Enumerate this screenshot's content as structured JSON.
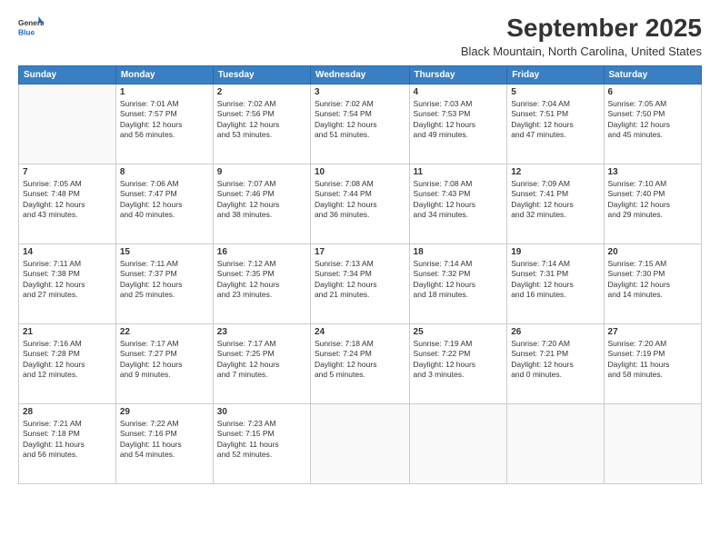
{
  "header": {
    "logo_general": "General",
    "logo_blue": "Blue",
    "month": "September 2025",
    "location": "Black Mountain, North Carolina, United States"
  },
  "columns": [
    "Sunday",
    "Monday",
    "Tuesday",
    "Wednesday",
    "Thursday",
    "Friday",
    "Saturday"
  ],
  "weeks": [
    [
      {
        "day": "",
        "info": ""
      },
      {
        "day": "1",
        "info": "Sunrise: 7:01 AM\nSunset: 7:57 PM\nDaylight: 12 hours\nand 56 minutes."
      },
      {
        "day": "2",
        "info": "Sunrise: 7:02 AM\nSunset: 7:56 PM\nDaylight: 12 hours\nand 53 minutes."
      },
      {
        "day": "3",
        "info": "Sunrise: 7:02 AM\nSunset: 7:54 PM\nDaylight: 12 hours\nand 51 minutes."
      },
      {
        "day": "4",
        "info": "Sunrise: 7:03 AM\nSunset: 7:53 PM\nDaylight: 12 hours\nand 49 minutes."
      },
      {
        "day": "5",
        "info": "Sunrise: 7:04 AM\nSunset: 7:51 PM\nDaylight: 12 hours\nand 47 minutes."
      },
      {
        "day": "6",
        "info": "Sunrise: 7:05 AM\nSunset: 7:50 PM\nDaylight: 12 hours\nand 45 minutes."
      }
    ],
    [
      {
        "day": "7",
        "info": "Sunrise: 7:05 AM\nSunset: 7:48 PM\nDaylight: 12 hours\nand 43 minutes."
      },
      {
        "day": "8",
        "info": "Sunrise: 7:06 AM\nSunset: 7:47 PM\nDaylight: 12 hours\nand 40 minutes."
      },
      {
        "day": "9",
        "info": "Sunrise: 7:07 AM\nSunset: 7:46 PM\nDaylight: 12 hours\nand 38 minutes."
      },
      {
        "day": "10",
        "info": "Sunrise: 7:08 AM\nSunset: 7:44 PM\nDaylight: 12 hours\nand 36 minutes."
      },
      {
        "day": "11",
        "info": "Sunrise: 7:08 AM\nSunset: 7:43 PM\nDaylight: 12 hours\nand 34 minutes."
      },
      {
        "day": "12",
        "info": "Sunrise: 7:09 AM\nSunset: 7:41 PM\nDaylight: 12 hours\nand 32 minutes."
      },
      {
        "day": "13",
        "info": "Sunrise: 7:10 AM\nSunset: 7:40 PM\nDaylight: 12 hours\nand 29 minutes."
      }
    ],
    [
      {
        "day": "14",
        "info": "Sunrise: 7:11 AM\nSunset: 7:38 PM\nDaylight: 12 hours\nand 27 minutes."
      },
      {
        "day": "15",
        "info": "Sunrise: 7:11 AM\nSunset: 7:37 PM\nDaylight: 12 hours\nand 25 minutes."
      },
      {
        "day": "16",
        "info": "Sunrise: 7:12 AM\nSunset: 7:35 PM\nDaylight: 12 hours\nand 23 minutes."
      },
      {
        "day": "17",
        "info": "Sunrise: 7:13 AM\nSunset: 7:34 PM\nDaylight: 12 hours\nand 21 minutes."
      },
      {
        "day": "18",
        "info": "Sunrise: 7:14 AM\nSunset: 7:32 PM\nDaylight: 12 hours\nand 18 minutes."
      },
      {
        "day": "19",
        "info": "Sunrise: 7:14 AM\nSunset: 7:31 PM\nDaylight: 12 hours\nand 16 minutes."
      },
      {
        "day": "20",
        "info": "Sunrise: 7:15 AM\nSunset: 7:30 PM\nDaylight: 12 hours\nand 14 minutes."
      }
    ],
    [
      {
        "day": "21",
        "info": "Sunrise: 7:16 AM\nSunset: 7:28 PM\nDaylight: 12 hours\nand 12 minutes."
      },
      {
        "day": "22",
        "info": "Sunrise: 7:17 AM\nSunset: 7:27 PM\nDaylight: 12 hours\nand 9 minutes."
      },
      {
        "day": "23",
        "info": "Sunrise: 7:17 AM\nSunset: 7:25 PM\nDaylight: 12 hours\nand 7 minutes."
      },
      {
        "day": "24",
        "info": "Sunrise: 7:18 AM\nSunset: 7:24 PM\nDaylight: 12 hours\nand 5 minutes."
      },
      {
        "day": "25",
        "info": "Sunrise: 7:19 AM\nSunset: 7:22 PM\nDaylight: 12 hours\nand 3 minutes."
      },
      {
        "day": "26",
        "info": "Sunrise: 7:20 AM\nSunset: 7:21 PM\nDaylight: 12 hours\nand 0 minutes."
      },
      {
        "day": "27",
        "info": "Sunrise: 7:20 AM\nSunset: 7:19 PM\nDaylight: 11 hours\nand 58 minutes."
      }
    ],
    [
      {
        "day": "28",
        "info": "Sunrise: 7:21 AM\nSunset: 7:18 PM\nDaylight: 11 hours\nand 56 minutes."
      },
      {
        "day": "29",
        "info": "Sunrise: 7:22 AM\nSunset: 7:16 PM\nDaylight: 11 hours\nand 54 minutes."
      },
      {
        "day": "30",
        "info": "Sunrise: 7:23 AM\nSunset: 7:15 PM\nDaylight: 11 hours\nand 52 minutes."
      },
      {
        "day": "",
        "info": ""
      },
      {
        "day": "",
        "info": ""
      },
      {
        "day": "",
        "info": ""
      },
      {
        "day": "",
        "info": ""
      }
    ]
  ]
}
